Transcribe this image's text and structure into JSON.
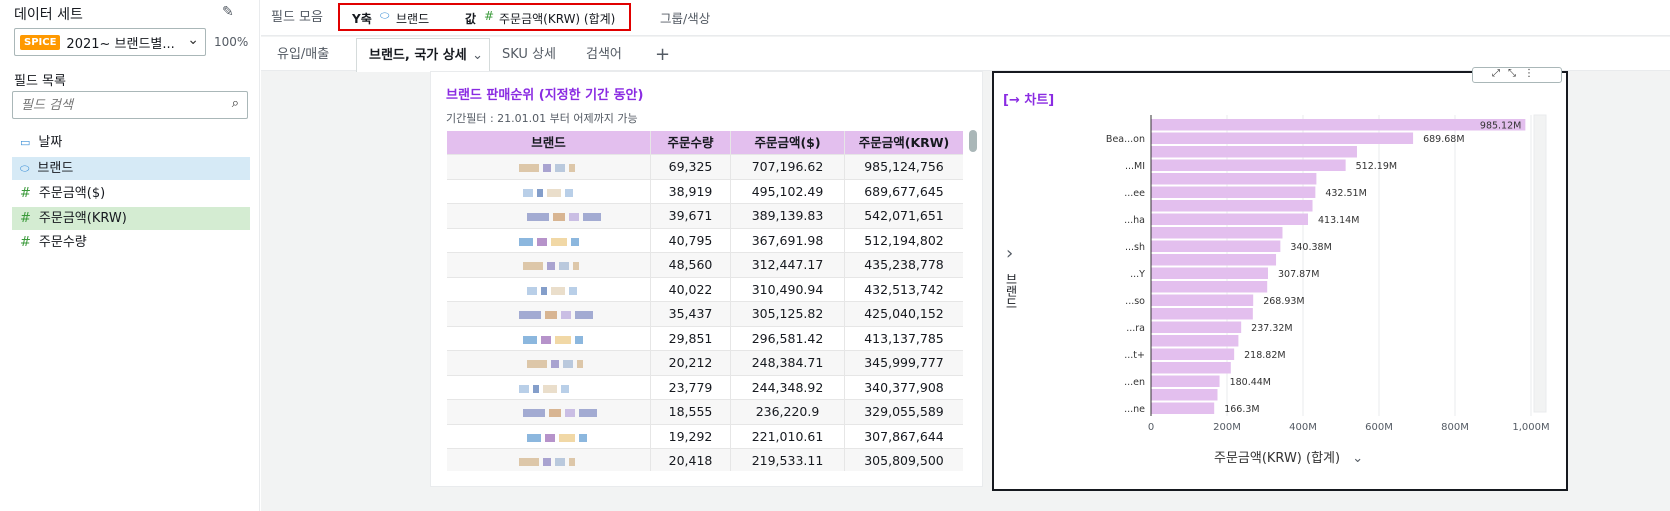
{
  "left": {
    "dataset_heading": "데이터 세트",
    "spice_badge": "SPICE",
    "dataset_name": "2021~ 브랜드별...",
    "spice_percent": "100%",
    "fields_heading": "필드 목록",
    "search_placeholder": "필드 검색",
    "fields": [
      {
        "icon": "calendar-icon",
        "label": "날짜"
      },
      {
        "icon": "tag-icon",
        "label": "브랜드"
      },
      {
        "icon": "hash-icon",
        "label": "주문금액($)"
      },
      {
        "icon": "hash-icon",
        "label": "주문금액(KRW)"
      },
      {
        "icon": "hash-icon",
        "label": "주문수량"
      }
    ]
  },
  "wells": {
    "label": "필드 모음",
    "y_label": "Y축",
    "y_value": "브랜드",
    "value_label": "값",
    "value_value": "주문금액(KRW) (합계)",
    "group_label": "그룹/색상"
  },
  "tabs": [
    "유입/매출",
    "브랜드, 국가 상세",
    "SKU 상세",
    "검색어"
  ],
  "add_tab": "+",
  "table_visual": {
    "title": "브랜드 판매순위 (지정한 기간 동안)",
    "subtitle": "기간필터 : 21.01.01 부터 어제까지 가능",
    "headers": [
      "브랜드",
      "주문수량",
      "주문금액($)",
      "주문금액(KRW)"
    ],
    "rows": [
      [
        "69,325",
        "707,196.62",
        "985,124,756"
      ],
      [
        "38,919",
        "495,102.49",
        "689,677,645"
      ],
      [
        "39,671",
        "389,139.83",
        "542,071,651"
      ],
      [
        "40,795",
        "367,691.98",
        "512,194,802"
      ],
      [
        "48,560",
        "312,447.17",
        "435,238,778"
      ],
      [
        "40,022",
        "310,490.94",
        "432,513,742"
      ],
      [
        "35,437",
        "305,125.82",
        "425,040,152"
      ],
      [
        "29,851",
        "296,581.42",
        "413,137,785"
      ],
      [
        "20,212",
        "248,384.71",
        "345,999,777"
      ],
      [
        "23,779",
        "244,348.92",
        "340,377,908"
      ],
      [
        "18,555",
        "236,220.9",
        "329,055,589"
      ],
      [
        "19,292",
        "221,010.61",
        "307,867,644"
      ],
      [
        "20,418",
        "219,533.11",
        "305,809,500"
      ]
    ]
  },
  "chart_visual": {
    "title": "[→ 차트]",
    "y_axis_title": "브랜드",
    "x_axis_title": "주문금액(KRW) (합계)"
  },
  "chart_data": {
    "type": "bar",
    "orientation": "horizontal",
    "categories": [
      "",
      "Bea...on",
      "",
      "...MI",
      "",
      "...ee",
      "",
      "...ha",
      "",
      "...sh",
      "",
      "...Y",
      "",
      "...so",
      "",
      "...ra",
      "",
      "...t+",
      "",
      "...en",
      "",
      "...ne"
    ],
    "values": [
      985.12,
      689.68,
      542.07,
      512.19,
      435.24,
      432.51,
      425.04,
      413.14,
      346.0,
      340.38,
      329.06,
      307.87,
      305.81,
      268.93,
      268.0,
      237.32,
      230.0,
      218.82,
      210.0,
      180.44,
      175.0,
      166.3
    ],
    "data_labels": [
      "985.12M",
      "689.68M",
      "",
      "512.19M",
      "",
      "432.51M",
      "",
      "413.14M",
      "",
      "340.38M",
      "",
      "307.87M",
      "",
      "268.93M",
      "",
      "237.32M",
      "",
      "218.82M",
      "",
      "180.44M",
      "",
      "166.3M"
    ],
    "xlim": [
      0,
      1000
    ],
    "x_ticks": [
      "0",
      "200M",
      "400M",
      "600M",
      "800M",
      "1,000M"
    ],
    "bar_color": "#e3bfee"
  },
  "colors": {
    "spice": "#ff9900",
    "highlight_red": "#e00000",
    "purple_title": "#8a2be2",
    "header_purple": "#e3bfee",
    "selected_blue": "#d6eaf6",
    "selected_green": "#d4ecd2"
  }
}
